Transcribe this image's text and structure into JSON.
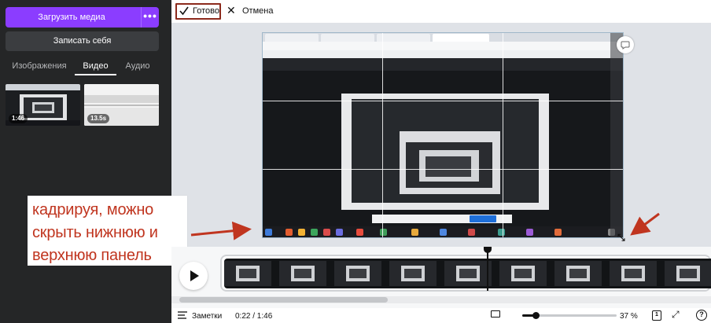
{
  "sidebar": {
    "upload_label": "Загрузить медиа",
    "more_label": "•••",
    "record_label": "Записать себя",
    "tabs": [
      {
        "label": "Изображения",
        "active": false
      },
      {
        "label": "Видео",
        "active": true
      },
      {
        "label": "Аудио",
        "active": false
      }
    ],
    "videos": [
      {
        "duration": "1:46"
      },
      {
        "duration": "13.5s"
      }
    ]
  },
  "toolbar": {
    "done_label": "Готово",
    "cancel_label": "Отмена"
  },
  "annotation": {
    "lines": [
      "кадрируя, можно",
      "скрыть нижнюю и",
      "верхнюю панель"
    ],
    "color": "#c0351f"
  },
  "bottombar": {
    "notes_label": "Заметки",
    "timecode": "0:22 / 1:46",
    "zoom": "37 %",
    "zoom_level": 0.37,
    "page_number": "1"
  },
  "colors": {
    "accent": "#8b3dff",
    "sidebar_bg": "#252627",
    "done_border": "#8c2a1c"
  },
  "icons": [
    "more-icon",
    "check-icon",
    "close-icon",
    "comment-icon",
    "resize-icon",
    "play-icon",
    "notes-icon",
    "screen-icon",
    "page-icon",
    "fullscreen-icon",
    "help-icon",
    "chevron-left-icon"
  ]
}
